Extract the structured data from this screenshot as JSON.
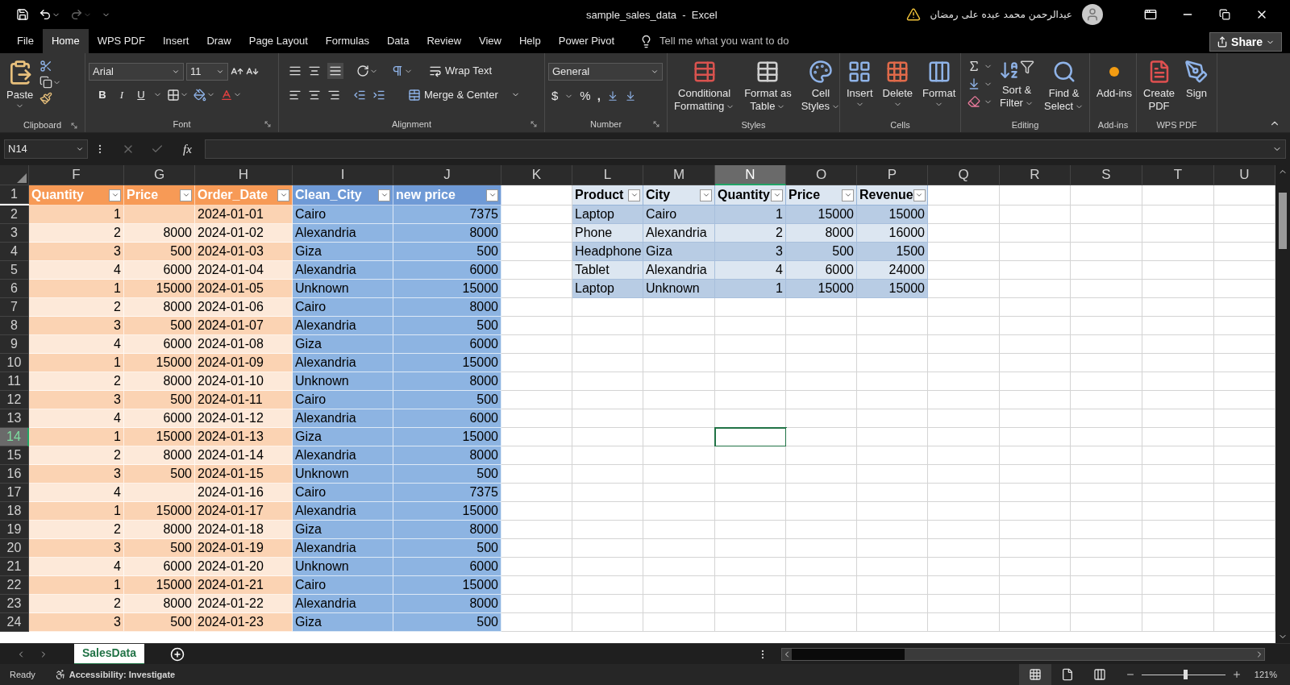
{
  "title_bar": {
    "title": "sample_sales_data  -  Excel",
    "user_name": "عبدالرحمن محمد عبده على رمضان"
  },
  "menu_tabs": [
    {
      "label": "File",
      "selected": false
    },
    {
      "label": "Home",
      "selected": true
    },
    {
      "label": "WPS PDF",
      "selected": false
    },
    {
      "label": "Insert",
      "selected": false
    },
    {
      "label": "Draw",
      "selected": false
    },
    {
      "label": "Page Layout",
      "selected": false
    },
    {
      "label": "Formulas",
      "selected": false
    },
    {
      "label": "Data",
      "selected": false
    },
    {
      "label": "Review",
      "selected": false
    },
    {
      "label": "View",
      "selected": false
    },
    {
      "label": "Help",
      "selected": false
    },
    {
      "label": "Power Pivot",
      "selected": false
    }
  ],
  "tell_me": {
    "placeholder": "Tell me what you want to do"
  },
  "share": "Share",
  "ribbon": {
    "paste": "Paste",
    "font_name": "Arial",
    "font_size": "11",
    "bold": "B",
    "italic": "I",
    "underline": "U",
    "wrap_text": "Wrap Text",
    "merge_center": "Merge & Center",
    "number_format": "General",
    "currency": "$",
    "percent": "%",
    "comma": ",",
    "conditional_formatting": [
      "Conditional",
      "Formatting"
    ],
    "format_as_table": [
      "Format as",
      "Table"
    ],
    "cell_styles": [
      "Cell",
      "Styles"
    ],
    "insert": "Insert",
    "delete": "Delete",
    "format": "Format",
    "sort_filter": [
      "Sort &",
      "Filter"
    ],
    "find_select": [
      "Find &",
      "Select"
    ],
    "add_ins": "Add-ins",
    "create_pdf": [
      "Create",
      "PDF"
    ],
    "sign": "Sign",
    "groups": [
      "Clipboard",
      "Font",
      "Alignment",
      "Number",
      "Styles",
      "Cells",
      "Editing",
      "Add-ins",
      "WPS PDF"
    ]
  },
  "formula_bar": {
    "name_box": "N14",
    "function_label": "fx"
  },
  "sheet": {
    "columns": [
      {
        "label": "F",
        "selected": false
      },
      {
        "label": "G",
        "selected": false
      },
      {
        "label": "H",
        "selected": false
      },
      {
        "label": "I",
        "selected": false
      },
      {
        "label": "J",
        "selected": false
      },
      {
        "label": "K",
        "selected": false
      },
      {
        "label": "L",
        "selected": false
      },
      {
        "label": "M",
        "selected": false
      },
      {
        "label": "N",
        "selected": true
      },
      {
        "label": "O",
        "selected": false
      },
      {
        "label": "P",
        "selected": false
      },
      {
        "label": "Q",
        "selected": false
      },
      {
        "label": "R",
        "selected": false
      },
      {
        "label": "S",
        "selected": false
      },
      {
        "label": "T",
        "selected": false
      },
      {
        "label": "U",
        "selected": false
      }
    ],
    "rows": [
      {
        "label": "1",
        "selected": false
      },
      {
        "label": "2",
        "selected": false
      },
      {
        "label": "3",
        "selected": false
      },
      {
        "label": "4",
        "selected": false
      },
      {
        "label": "5",
        "selected": false
      },
      {
        "label": "6",
        "selected": false
      },
      {
        "label": "7",
        "selected": false
      },
      {
        "label": "8",
        "selected": false
      },
      {
        "label": "9",
        "selected": false
      },
      {
        "label": "10",
        "selected": false
      },
      {
        "label": "11",
        "selected": false
      },
      {
        "label": "12",
        "selected": false
      },
      {
        "label": "13",
        "selected": false
      },
      {
        "label": "14",
        "selected": true
      },
      {
        "label": "15",
        "selected": false
      },
      {
        "label": "16",
        "selected": false
      },
      {
        "label": "17",
        "selected": false
      },
      {
        "label": "18",
        "selected": false
      },
      {
        "label": "19",
        "selected": false
      },
      {
        "label": "20",
        "selected": false
      },
      {
        "label": "21",
        "selected": false
      },
      {
        "label": "22",
        "selected": false
      },
      {
        "label": "23",
        "selected": false
      },
      {
        "label": "24",
        "selected": false
      }
    ],
    "sales_table": {
      "headers": [
        {
          "label": "Quantity",
          "kind": "source"
        },
        {
          "label": "Price",
          "kind": "source"
        },
        {
          "label": "Order_Date",
          "kind": "source"
        },
        {
          "label": "Clean_City",
          "kind": "derived"
        },
        {
          "label": "new price",
          "kind": "derived"
        }
      ],
      "rows": [
        {
          "quantity": "1",
          "order_date": "2024-01-01",
          "clean_city": "Cairo",
          "new_price": "7375"
        },
        {
          "quantity": "2",
          "price": "8000",
          "order_date": "2024-01-02",
          "clean_city": "Alexandria",
          "new_price": "8000"
        },
        {
          "quantity": "3",
          "price": "500",
          "order_date": "2024-01-03",
          "clean_city": "Giza",
          "new_price": "500"
        },
        {
          "quantity": "4",
          "price": "6000",
          "order_date": "2024-01-04",
          "clean_city": "Alexandria",
          "new_price": "6000"
        },
        {
          "quantity": "1",
          "price": "15000",
          "order_date": "2024-01-05",
          "clean_city": "Unknown",
          "new_price": "15000"
        },
        {
          "quantity": "2",
          "price": "8000",
          "order_date": "2024-01-06",
          "clean_city": "Cairo",
          "new_price": "8000"
        },
        {
          "quantity": "3",
          "price": "500",
          "order_date": "2024-01-07",
          "clean_city": "Alexandria",
          "new_price": "500"
        },
        {
          "quantity": "4",
          "price": "6000",
          "order_date": "2024-01-08",
          "clean_city": "Giza",
          "new_price": "6000"
        },
        {
          "quantity": "1",
          "price": "15000",
          "order_date": "2024-01-09",
          "clean_city": "Alexandria",
          "new_price": "15000"
        },
        {
          "quantity": "2",
          "price": "8000",
          "order_date": "2024-01-10",
          "clean_city": "Unknown",
          "new_price": "8000"
        },
        {
          "quantity": "3",
          "price": "500",
          "order_date": "2024-01-11",
          "clean_city": "Cairo",
          "new_price": "500"
        },
        {
          "quantity": "4",
          "price": "6000",
          "order_date": "2024-01-12",
          "clean_city": "Alexandria",
          "new_price": "6000"
        },
        {
          "quantity": "1",
          "price": "15000",
          "order_date": "2024-01-13",
          "clean_city": "Giza",
          "new_price": "15000"
        },
        {
          "quantity": "2",
          "price": "8000",
          "order_date": "2024-01-14",
          "clean_city": "Alexandria",
          "new_price": "8000"
        },
        {
          "quantity": "3",
          "price": "500",
          "order_date": "2024-01-15",
          "clean_city": "Unknown",
          "new_price": "500"
        },
        {
          "quantity": "4",
          "order_date": "2024-01-16",
          "clean_city": "Cairo",
          "new_price": "7375"
        },
        {
          "quantity": "1",
          "price": "15000",
          "order_date": "2024-01-17",
          "clean_city": "Alexandria",
          "new_price": "15000"
        },
        {
          "quantity": "2",
          "price": "8000",
          "order_date": "2024-01-18",
          "clean_city": "Giza",
          "new_price": "8000"
        },
        {
          "quantity": "3",
          "price": "500",
          "order_date": "2024-01-19",
          "clean_city": "Alexandria",
          "new_price": "500"
        },
        {
          "quantity": "4",
          "price": "6000",
          "order_date": "2024-01-20",
          "clean_city": "Unknown",
          "new_price": "6000"
        },
        {
          "quantity": "1",
          "price": "15000",
          "order_date": "2024-01-21",
          "clean_city": "Cairo",
          "new_price": "15000"
        },
        {
          "quantity": "2",
          "price": "8000",
          "order_date": "2024-01-22",
          "clean_city": "Alexandria",
          "new_price": "8000"
        },
        {
          "quantity": "3",
          "price": "500",
          "order_date": "2024-01-23",
          "clean_city": "Giza",
          "new_price": "500"
        }
      ]
    },
    "revenue_table": {
      "headers": [
        "Product",
        "City",
        "Quantity",
        "Price",
        "Revenue"
      ],
      "rows": [
        {
          "product": "Laptop",
          "city": "Cairo",
          "quantity": "1",
          "price": "15000",
          "revenue": "15000"
        },
        {
          "product": "Phone",
          "city": "Alexandria",
          "quantity": "2",
          "price": "8000",
          "revenue": "16000"
        },
        {
          "product": "Headphone",
          "city": "Giza",
          "quantity": "3",
          "price": "500",
          "revenue": "1500"
        },
        {
          "product": "Tablet",
          "city": "Alexandria",
          "quantity": "4",
          "price": "6000",
          "revenue": "24000"
        },
        {
          "product": "Laptop",
          "city": "Unknown",
          "quantity": "1",
          "price": "15000",
          "revenue": "15000"
        }
      ]
    }
  },
  "sheet_tabs": [
    {
      "label": "SalesData",
      "selected": true
    }
  ],
  "status_bar": {
    "status": "Ready",
    "accessibility": "Accessibility: Investigate",
    "zoom": "121%",
    "zoom_slider": {
      "level": 0.52
    }
  }
}
